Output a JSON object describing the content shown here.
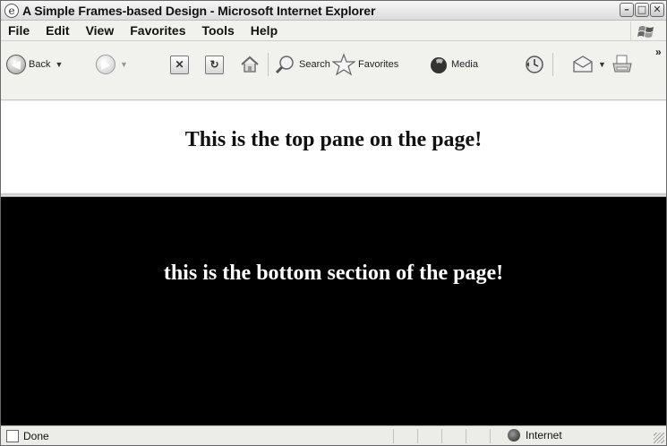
{
  "window": {
    "title": "A Simple Frames-based Design - Microsoft Internet Explorer",
    "app_icon": "e",
    "minimize": "–",
    "maximize": "□",
    "close": "✕"
  },
  "menu": {
    "items": [
      "File",
      "Edit",
      "View",
      "Favorites",
      "Tools",
      "Help"
    ]
  },
  "toolbar": {
    "back_label": "Back",
    "search_label": "Search",
    "favorites_label": "Favorites",
    "media_label": "Media",
    "overflow": "»"
  },
  "content": {
    "top_text": "This is the top pane on the page!",
    "bottom_text": "this is the bottom section of the page!"
  },
  "status": {
    "text": "Done",
    "zone": "Internet"
  }
}
